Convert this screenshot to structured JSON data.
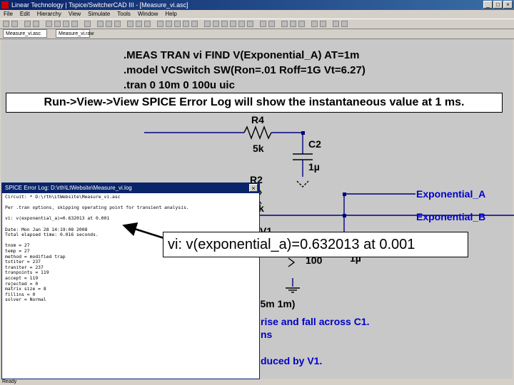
{
  "window": {
    "title": "Linear Technology | Tspice/SwitcherCAD III - [Measure_vi.asc]",
    "buttons": [
      "_",
      "□",
      "×"
    ]
  },
  "menu": [
    "File",
    "Edit",
    "Hierarchy",
    "View",
    "Simulate",
    "Tools",
    "Window",
    "Help"
  ],
  "tabs": [
    "Measure_vi.asc",
    "Measure_vi.raw"
  ],
  "spice_directives": [
    ".MEAS TRAN vi FIND V(Exponential_A) AT=1m",
    ".model VCSwitch SW(Ron=.01 Roff=1G Vt=6.27)",
    ".tran 0 10m 0 100u uic"
  ],
  "banner": "Run->View->View SPICE Error Log will show the instantaneous value at 1 ms.",
  "schematic": {
    "r4_name": "R4",
    "r4_value": "5k",
    "c2_name": "C2",
    "c2_value": "1µ",
    "r2_name": "R2",
    "r2_value_partial": "k",
    "v1_partial": "V1",
    "value_100": "100",
    "value_1u": "1µ",
    "net_a": "Exponential_A",
    "net_b": "Exponential_B",
    "pulse_partial": "n 5m 1m)",
    "note_1": "rise and fall across C1.",
    "note_2": "ns",
    "note_3": "duced by V1."
  },
  "log_window": {
    "title": "SPICE Error Log: D:\\rth\\LtWebsite\\Measure_vi.log",
    "close": "×",
    "lines": [
      "Circuit: * D:\\rth\\LtWebsite\\Measure_vi.asc",
      "",
      "Per .tran options, skipping operating point for transient analysis.",
      "",
      "vi: v(exponential_a)=0.632013 at 0.001",
      "",
      "Date: Mon Jan 28 14:19:08 2008",
      "Total elapsed time: 0.016 seconds.",
      "",
      "tnom = 27",
      "temp = 27",
      "method = modified trap",
      "totiter = 237",
      "traniter = 237",
      "tranpoints = 119",
      "accept = 119",
      "rejected = 0",
      "matrix size = 8",
      "fillins = 0",
      "solver = Normal"
    ]
  },
  "callout": "vi: v(exponential_a)=0.632013 at 0.001",
  "status": "Ready",
  "colors": {
    "title_bar": "#0a246a",
    "canvas": "#c8c8c8",
    "wire": "#000080",
    "net_label": "#0000c8"
  }
}
